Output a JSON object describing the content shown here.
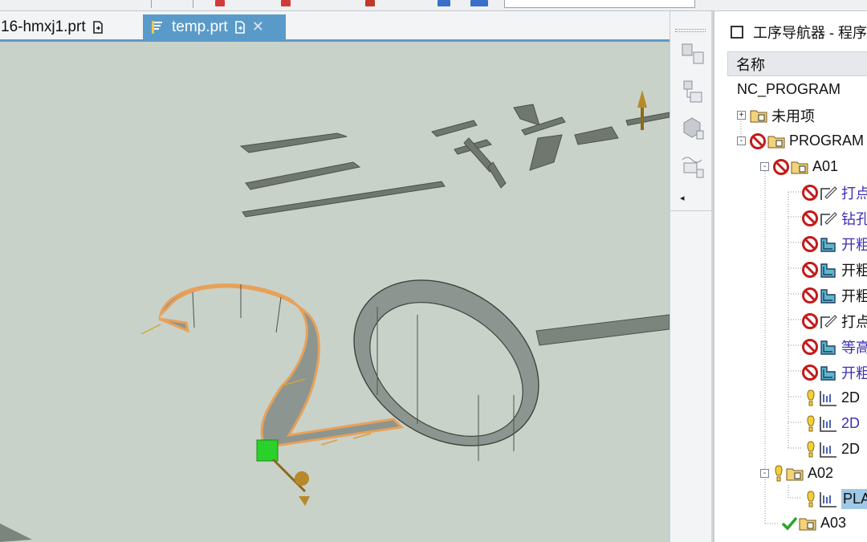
{
  "tabs": [
    {
      "label": "16-hmxj1.prt",
      "active": false
    },
    {
      "label": "temp.prt",
      "active": true
    }
  ],
  "viewport": {
    "background": "#c9d2c9",
    "highlight_color": "#e7a15a",
    "wall_color": "#8d9590",
    "handle_color": "#2ad12a"
  },
  "navigator": {
    "title": "工序导航器 - 程序顺序",
    "column_name": "名称",
    "items": [
      {
        "label": "NC_PROGRAM",
        "level": 0,
        "status": "none",
        "icon": "none"
      },
      {
        "label": "未用项",
        "level": 1,
        "status": "none",
        "icon": "group-folder-icon",
        "expander": "+"
      },
      {
        "label": "PROGRAM",
        "level": 1,
        "status": "prohibited",
        "icon": "group-folder-icon",
        "expander": "-"
      },
      {
        "label": "A01",
        "level": 2,
        "status": "prohibited",
        "icon": "group-folder-icon",
        "expander": "-"
      },
      {
        "label": "打点",
        "level": 3,
        "status": "prohibited",
        "icon": "drill-op-icon",
        "color": "purple"
      },
      {
        "label": "钻孔",
        "level": 3,
        "status": "prohibited",
        "icon": "drill-op-icon",
        "color": "purple"
      },
      {
        "label": "开粗",
        "level": 3,
        "status": "prohibited",
        "icon": "cavity-mill-icon",
        "color": "purple"
      },
      {
        "label": "开粗",
        "level": 3,
        "status": "prohibited",
        "icon": "cavity-mill-icon"
      },
      {
        "label": "开粗",
        "level": 3,
        "status": "prohibited",
        "icon": "cavity-mill-icon"
      },
      {
        "label": "打点",
        "level": 3,
        "status": "prohibited",
        "icon": "drill-op-icon"
      },
      {
        "label": "等高",
        "level": 3,
        "status": "prohibited",
        "icon": "cavity-mill-icon",
        "color": "purple"
      },
      {
        "label": "开粗",
        "level": 3,
        "status": "prohibited",
        "icon": "cavity-mill-icon",
        "color": "purple"
      },
      {
        "label": "2D",
        "level": 3,
        "status": "regenerate",
        "icon": "planar-mill-icon"
      },
      {
        "label": "2D",
        "level": 3,
        "status": "regenerate",
        "icon": "planar-mill-icon",
        "color": "purple"
      },
      {
        "label": "2D",
        "level": 3,
        "status": "regenerate",
        "icon": "planar-mill-icon"
      },
      {
        "label": "A02",
        "level": 2,
        "status": "regenerate",
        "icon": "group-folder-icon",
        "expander": "-"
      },
      {
        "label": "PLA",
        "level": 3,
        "status": "regenerate",
        "icon": "planar-mill-icon",
        "selected": true
      },
      {
        "label": "A03",
        "level": 2,
        "status": "complete",
        "icon": "group-folder-icon"
      }
    ]
  },
  "colors": {
    "tab_active": "#5a9ac9",
    "selection": "#9fc8e6",
    "prohibited": "#c41a1a",
    "complete": "#2aa52a",
    "regenerate": "#e3b51c",
    "purple_text": "#3c2fb5"
  }
}
